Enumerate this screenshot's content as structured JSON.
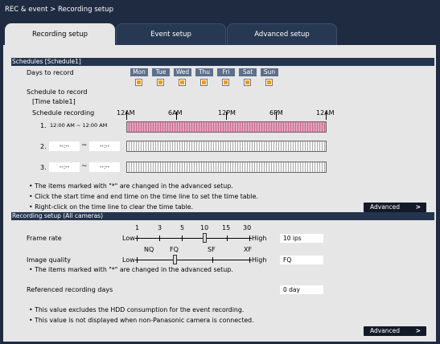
{
  "header": {
    "title": "REC & event > Recording setup"
  },
  "tabs": [
    {
      "label": "Recording setup",
      "active": true
    },
    {
      "label": "Event setup"
    },
    {
      "label": "Advanced setup"
    }
  ],
  "schedules": {
    "section_title": "Schedules [Schedule1]",
    "days_label": "Days to record",
    "days": [
      "Mon",
      "Tue",
      "Wed",
      "Thu",
      "Fri",
      "Sat",
      "Sun"
    ],
    "days_checked": [
      true,
      true,
      true,
      true,
      true,
      true,
      true
    ],
    "schedule_label": "Schedule to record",
    "time_table": "[Time table1]",
    "schedule_recording": "Schedule recording",
    "time_axis": [
      "12AM",
      "6AM",
      "12PM",
      "6PM",
      "12AM"
    ],
    "rows": [
      {
        "num": "1.",
        "range": "12:00 AM ~ 12:00 AM",
        "recording": true
      },
      {
        "num": "2.",
        "start": "--:--",
        "sep": "~",
        "end": "--:--",
        "recording": false
      },
      {
        "num": "3.",
        "start": "--:--",
        "sep": "~",
        "end": "--:--",
        "recording": false
      }
    ],
    "notes": [
      "• The items marked with \"*\" are changed in the advanced setup.",
      "• Click the start time and end time on the time line to set the time table.",
      "• Right-click on the time line to clear the time table."
    ],
    "advanced_label": "Advanced"
  },
  "recording": {
    "section_title": "Recording setup (All cameras)",
    "frame_rate": {
      "label": "Frame rate",
      "low": "Low",
      "high": "High",
      "ticks": [
        "1",
        "3",
        "5",
        "10",
        "15",
        "30"
      ],
      "value": "10 ips",
      "selected_index": 3
    },
    "image_quality": {
      "label": "Image quality",
      "low": "Low",
      "high": "High",
      "ticks": [
        "NQ",
        "FQ",
        "SF",
        "XF"
      ],
      "value": "FQ",
      "selected_index": 1
    },
    "note_advanced": "• The items marked with \"*\" are changed in the advanced setup.",
    "referenced_days": {
      "label": "Referenced recording days",
      "value": "0 day"
    },
    "notes": [
      "• This value excludes the HDD consumption for the event recording.",
      "• This value is not displayed when non-Panasonic camera is connected."
    ],
    "advanced_label": "Advanced"
  },
  "colors": {
    "background": "#1e2b41",
    "panel": "#e6e6e6",
    "recorded": "#c96891",
    "checkbox": "#f59a00"
  }
}
